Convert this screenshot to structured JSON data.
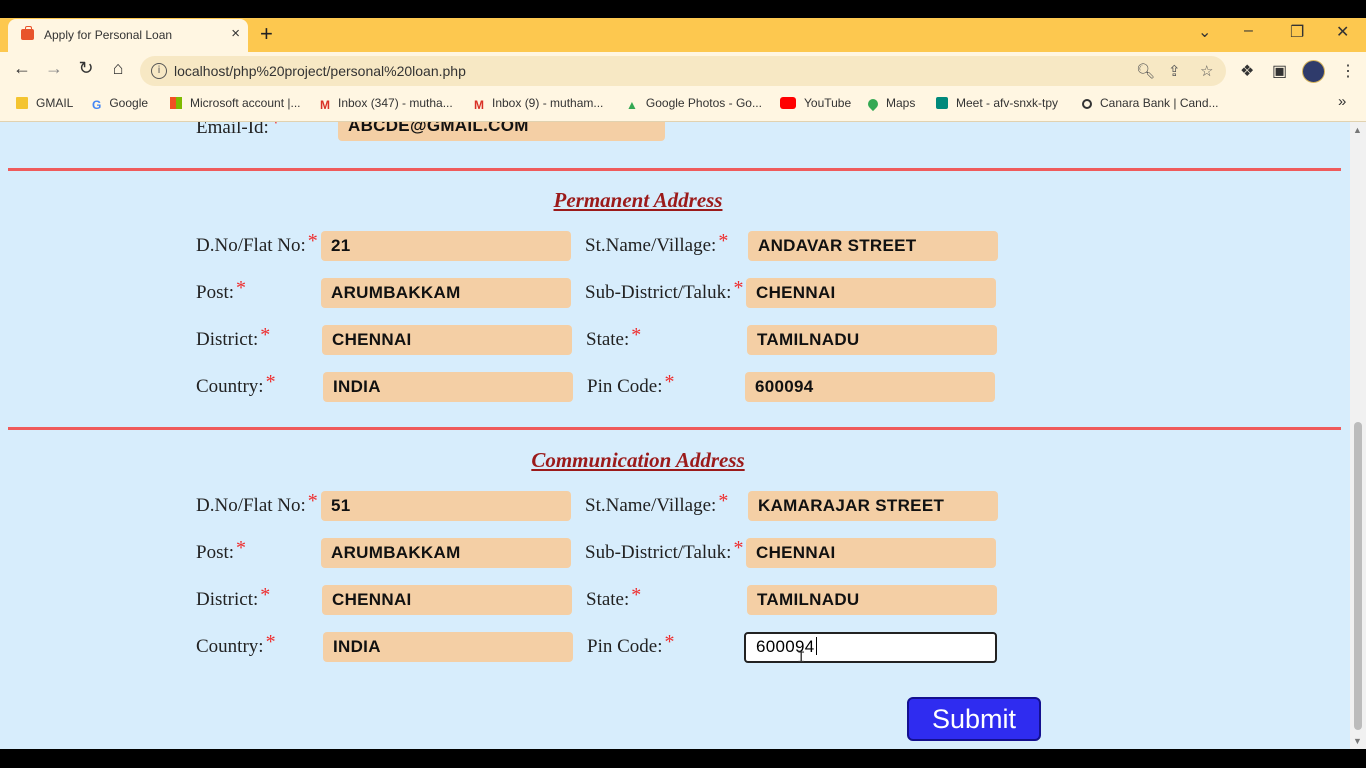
{
  "browser": {
    "tab_title": "Apply for Personal Loan",
    "tab_close": "×",
    "new_tab": "+",
    "url": "localhost/php%20project/personal%20loan.php",
    "window_controls": {
      "dropdown": "⌄",
      "minimize": "–",
      "restore": "❐",
      "close": "✕"
    },
    "nav": {
      "back": "←",
      "forward": "→",
      "reload": "↻",
      "home": "⌂"
    },
    "bookmarks": [
      {
        "label": "GMAIL",
        "icon": "folder-icon",
        "color": "#f4c430"
      },
      {
        "label": "Google",
        "icon": "google-icon",
        "color": "#4285f4"
      },
      {
        "label": "Microsoft account |...",
        "icon": "microsoft-icon",
        "color": "#f25022"
      },
      {
        "label": "Inbox (347) - mutha...",
        "icon": "gmail-icon",
        "color": "#d93025"
      },
      {
        "label": "Inbox (9) - mutham...",
        "icon": "gmail-icon",
        "color": "#d93025"
      },
      {
        "label": "Google Photos - Go...",
        "icon": "google-drive-icon",
        "color": "#34a853"
      },
      {
        "label": "YouTube",
        "icon": "youtube-icon",
        "color": "#ff0000"
      },
      {
        "label": "Maps",
        "icon": "maps-pin-icon",
        "color": "#34a853"
      },
      {
        "label": "Meet - afv-snxk-tpy",
        "icon": "meet-icon",
        "color": "#00897b"
      },
      {
        "label": "Canara Bank | Cand...",
        "icon": "globe-icon",
        "color": "#333333"
      }
    ],
    "bookmarks_overflow": "»"
  },
  "form": {
    "email": {
      "label": "Email-Id:",
      "value": "ABCDE@GMAIL.COM"
    },
    "required_mark": "*",
    "permanent": {
      "title": "Permanent Address",
      "dno": {
        "label": "D.No/Flat No:",
        "value": "21"
      },
      "street": {
        "label": "St.Name/Village:",
        "value": "ANDAVAR STREET"
      },
      "post": {
        "label": "Post:",
        "value": "ARUMBAKKAM"
      },
      "taluk": {
        "label": "Sub-District/Taluk:",
        "value": "CHENNAI"
      },
      "district": {
        "label": "District:",
        "value": "CHENNAI"
      },
      "state": {
        "label": "State:",
        "value": "TAMILNADU"
      },
      "country": {
        "label": "Country:",
        "value": "INDIA"
      },
      "pincode": {
        "label": "Pin Code:",
        "value": "600094"
      }
    },
    "communication": {
      "title": "Communication Address",
      "dno": {
        "label": "D.No/Flat No:",
        "value": "51"
      },
      "street": {
        "label": "St.Name/Village:",
        "value": "KAMARAJAR STREET"
      },
      "post": {
        "label": "Post:",
        "value": "ARUMBAKKAM"
      },
      "taluk": {
        "label": "Sub-District/Taluk:",
        "value": "CHENNAI"
      },
      "district": {
        "label": "District:",
        "value": "CHENNAI"
      },
      "state": {
        "label": "State:",
        "value": "TAMILNADU"
      },
      "country": {
        "label": "Country:",
        "value": "INDIA"
      },
      "pincode": {
        "label": "Pin Code:",
        "value": "600094"
      }
    },
    "submit_label": "Submit"
  },
  "colors": {
    "accent": "#2f2cf0",
    "field_bg": "#f4cfa5",
    "page_bg": "#d7edfc",
    "divider": "#ef5b5b",
    "title": "#9b1a1a"
  }
}
